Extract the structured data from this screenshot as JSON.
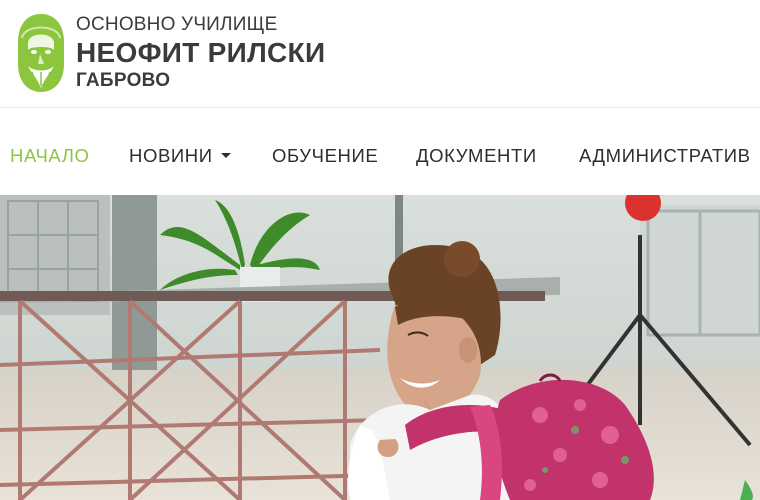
{
  "logo": {
    "line1": "ОСНОВНО УЧИЛИЩЕ",
    "line2": "НЕОФИТ РИЛСКИ",
    "line3": "ГАБРОВО",
    "accent_color": "#8cc63f"
  },
  "nav": {
    "items": [
      {
        "label": "НАЧАЛО",
        "active": true
      },
      {
        "label": "НОВИНИ",
        "dropdown": true
      },
      {
        "label": "ОБУЧЕНИЕ"
      },
      {
        "label": "ДОКУМЕНТИ"
      },
      {
        "label": "АДМИНИСТРАТИВ"
      }
    ],
    "active_color": "#8cc63f",
    "text_color": "#2e2e2e"
  },
  "hero": {
    "icon": "hero-photo-schoolgirl-with-backpack"
  }
}
